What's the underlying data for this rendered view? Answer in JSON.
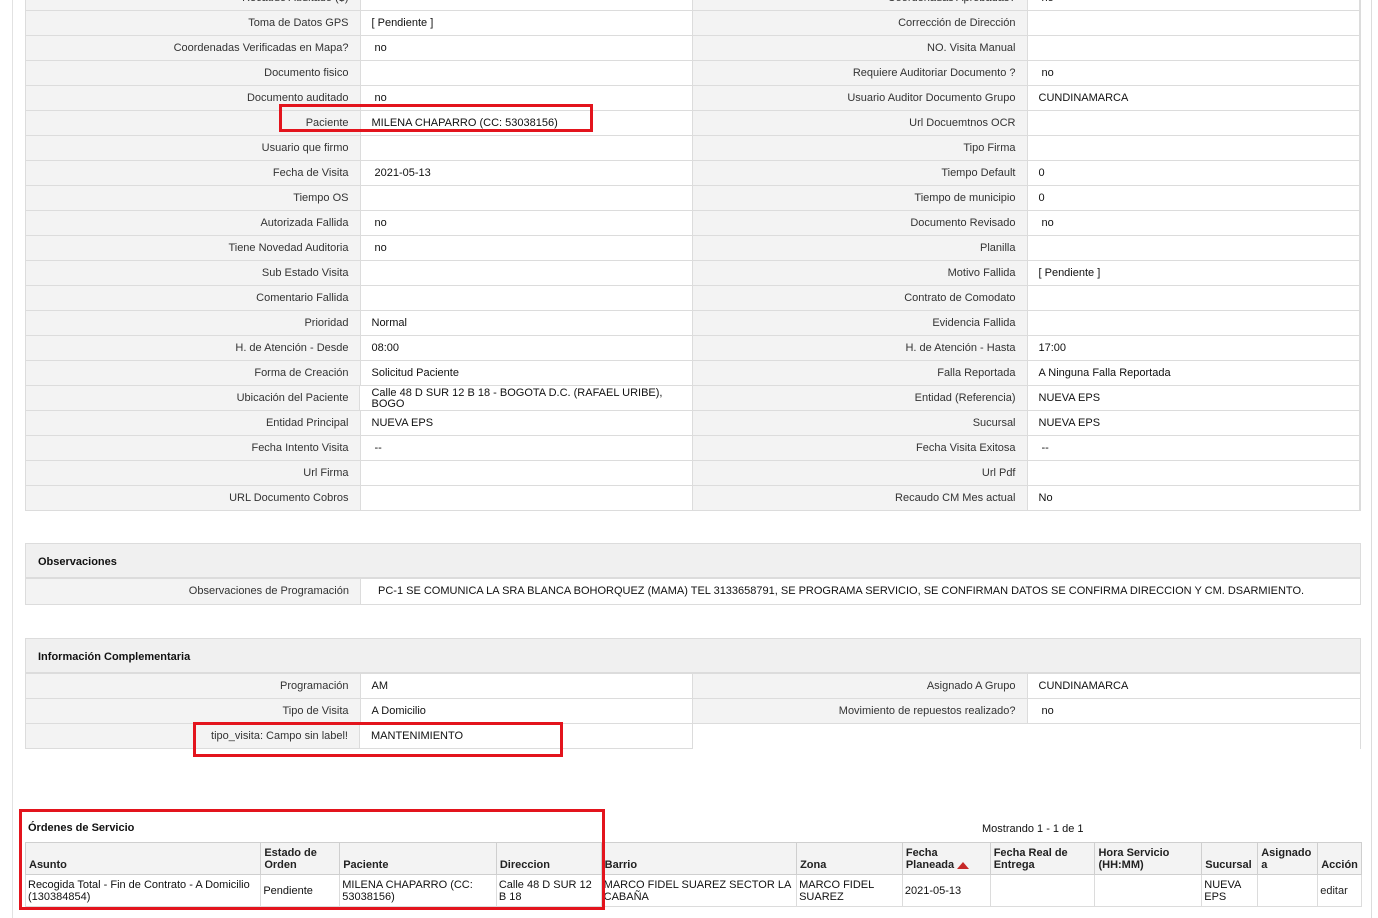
{
  "detail_rows": [
    {
      "l1": "Recaudo Auditado ($)",
      "v1": "",
      "l2": "Coordenadas Aprobadas?",
      "v2": "no"
    },
    {
      "l1": "Toma de Datos GPS",
      "v1": "[ Pendiente ]",
      "l2": "Corrección de Dirección",
      "v2": ""
    },
    {
      "l1": "Coordenadas Verificadas en Mapa?",
      "v1": "no",
      "l2": "NO. Visita Manual",
      "v2": ""
    },
    {
      "l1": "Documento fisico",
      "v1": "",
      "l2": "Requiere Auditoriar Documento ?",
      "v2": "no"
    },
    {
      "l1": "Documento auditado",
      "v1": "no",
      "l2": "Usuario Auditor Documento Grupo",
      "v2": "CUNDINAMARCA"
    },
    {
      "l1": "Paciente",
      "v1": "MILENA CHAPARRO (CC: 53038156)",
      "l2": "Url Docuemtnos OCR",
      "v2": ""
    },
    {
      "l1": "Usuario que firmo",
      "v1": "",
      "l2": "Tipo Firma",
      "v2": ""
    },
    {
      "l1": "Fecha de Visita",
      "v1": "2021-05-13",
      "l2": "Tiempo Default",
      "v2": "0"
    },
    {
      "l1": "Tiempo OS",
      "v1": "",
      "l2": "Tiempo de municipio",
      "v2": "0"
    },
    {
      "l1": "Autorizada Fallida",
      "v1": "no",
      "l2": "Documento Revisado",
      "v2": "no"
    },
    {
      "l1": "Tiene Novedad Auditoria",
      "v1": "no",
      "l2": "Planilla",
      "v2": ""
    },
    {
      "l1": "Sub Estado Visita",
      "v1": "",
      "l2": "Motivo Fallida",
      "v2": "[ Pendiente ]"
    },
    {
      "l1": "Comentario Fallida",
      "v1": "",
      "l2": "Contrato de Comodato",
      "v2": ""
    },
    {
      "l1": "Prioridad",
      "v1": "Normal",
      "l2": "Evidencia Fallida",
      "v2": ""
    },
    {
      "l1": "H. de Atención - Desde",
      "v1": "08:00",
      "l2": "H. de Atención - Hasta",
      "v2": "17:00"
    },
    {
      "l1": "Forma de Creación",
      "v1": "Solicitud Paciente",
      "l2": "Falla Reportada",
      "v2": "A Ninguna Falla Reportada"
    },
    {
      "l1": "Ubicación del Paciente",
      "v1": "Calle 48 D SUR 12 B 18 - BOGOTA D.C. (RAFAEL URIBE), BOGO",
      "l2": "Entidad (Referencia)",
      "v2": "NUEVA EPS"
    },
    {
      "l1": "Entidad Principal",
      "v1": "NUEVA EPS",
      "l2": "Sucursal",
      "v2": "NUEVA EPS"
    },
    {
      "l1": "Fecha Intento Visita",
      "v1": "--",
      "l2": "Fecha Visita Exitosa",
      "v2": "--"
    },
    {
      "l1": "Url Firma",
      "v1": "",
      "l2": "Url Pdf",
      "v2": ""
    },
    {
      "l1": "URL Documento Cobros",
      "v1": "",
      "l2": "Recaudo CM Mes actual",
      "v2": "No"
    }
  ],
  "observaciones": {
    "title": "Observaciones",
    "label": "Observaciones de Programación",
    "value": "PC-1 SE COMUNICA LA SRA BLANCA BOHORQUEZ (MAMA) TEL 3133658791, SE PROGRAMA SERVICIO, SE CONFIRMAN DATOS SE CONFIRMA DIRECCION Y CM. DSARMIENTO."
  },
  "complementaria": {
    "title": "Información Complementaria",
    "rows": [
      {
        "l1": "Programación",
        "v1": "AM",
        "l2": "Asignado A Grupo",
        "v2": "CUNDINAMARCA"
      },
      {
        "l1": "Tipo de Visita",
        "v1": "A Domicilio",
        "l2": "Movimiento de repuestos realizado?",
        "v2": "no"
      },
      {
        "l1": "tipo_visita: Campo sin label!",
        "v1": "MANTENIMIENTO"
      }
    ]
  },
  "orders": {
    "title": "Órdenes de Servicio",
    "showing": "Mostrando 1 - 1 de 1",
    "headers": [
      "Asunto",
      "Estado de Orden",
      "Paciente",
      "Direccion",
      "Barrio",
      "Zona",
      "Fecha Planeada",
      "Fecha Real de Entrega",
      "Hora Servicio (HH:MM)",
      "Sucursal",
      "Asignado a",
      "Acción"
    ],
    "rows": [
      {
        "asunto": "Recogida Total - Fin de Contrato - A Domicilio (130384854)",
        "estado": "Pendiente",
        "paciente": "MILENA CHAPARRO (CC: 53038156)",
        "direccion": "Calle 48 D SUR 12 B 18",
        "barrio": "MARCO FIDEL SUAREZ SECTOR LA CABAÑA",
        "zona": "MARCO FIDEL SUAREZ",
        "fecha_planeada": "2021-05-13",
        "fecha_real": "",
        "hora": "",
        "sucursal": "NUEVA EPS",
        "asignado": "",
        "accion": "editar"
      }
    ]
  },
  "colors": {
    "highlight": "#e3141d",
    "sort_arrow": "#c62828",
    "label_bg": "#f3f3f3",
    "border": "#dcdcdc"
  }
}
